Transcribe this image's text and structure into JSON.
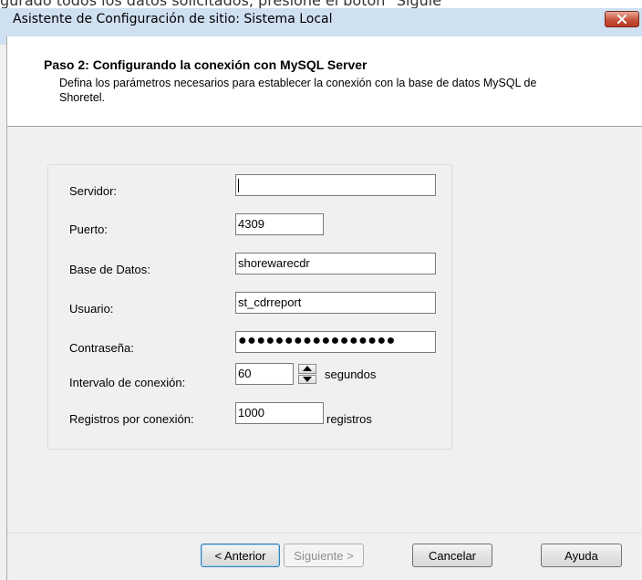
{
  "background_caption": "gurado todos los datos solicitados, presione el botón \"Siguie",
  "window": {
    "title": "Asistente de Configuración de sitio: Sistema Local"
  },
  "header": {
    "step_title": "Paso 2: Configurando la conexión con MySQL Server",
    "step_description": "Defina los parámetros necesarios para establecer la conexión con la base de datos MySQL de Shoretel."
  },
  "form": {
    "servidor": {
      "label": "Servidor:",
      "value": ""
    },
    "puerto": {
      "label": "Puerto:",
      "value": "4309"
    },
    "base_datos": {
      "label": "Base de Datos:",
      "value": "shorewarecdr"
    },
    "usuario": {
      "label": "Usuario:",
      "value": "st_cdrreport"
    },
    "contrasena": {
      "label": "Contraseña:",
      "value": "●●●●●●●●●●●●●●●●●"
    },
    "intervalo": {
      "label": "Intervalo de conexión:",
      "value": "60",
      "unit": "segundos"
    },
    "registros": {
      "label": "Registros por conexión:",
      "value": "1000",
      "unit": "registros"
    }
  },
  "buttons": {
    "anterior": "< Anterior",
    "siguiente": "Siguiente >",
    "cancelar": "Cancelar",
    "ayuda": "Ayuda"
  },
  "icons": {
    "close": "close-icon",
    "spin_up": "arrow-up-icon",
    "spin_down": "arrow-down-icon"
  },
  "colors": {
    "titlebar": "#cfe0f1",
    "close_button": "#c7533d",
    "dialog_bg": "#f0f0f0"
  }
}
